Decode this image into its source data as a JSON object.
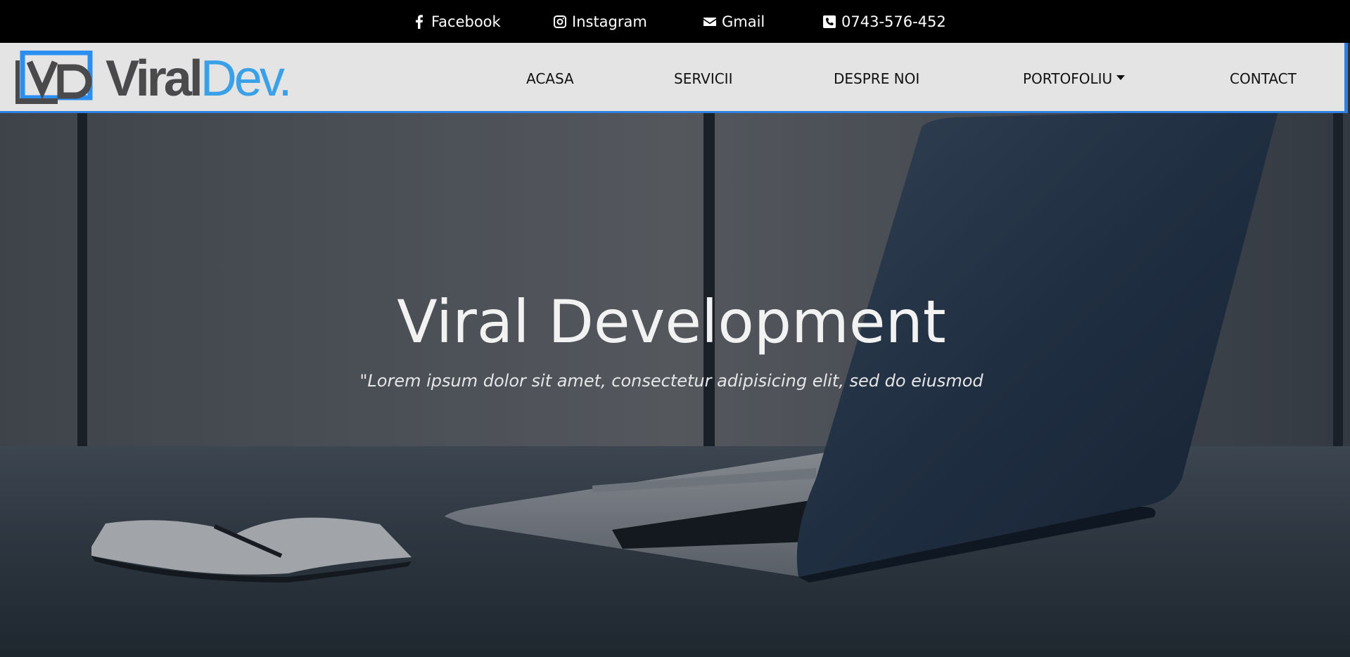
{
  "topbar": {
    "facebook": {
      "label": "Facebook",
      "icon": "facebook-icon"
    },
    "instagram": {
      "label": "Instagram",
      "icon": "instagram-icon"
    },
    "gmail": {
      "label": "Gmail",
      "icon": "envelope-icon"
    },
    "phone": {
      "label": "0743-576-452",
      "icon": "phone-icon"
    }
  },
  "brand": {
    "mark": "VD",
    "name_part1": "Viral",
    "name_part2": "Dev."
  },
  "nav": {
    "items": [
      {
        "label": "ACASA"
      },
      {
        "label": "SERVICII"
      },
      {
        "label": "DESPRE NOI"
      },
      {
        "label": "PORTOFOLIU",
        "has_dropdown": true
      },
      {
        "label": "CONTACT"
      }
    ]
  },
  "hero": {
    "title": "Viral Development",
    "subtitle": "\"Lorem ipsum dolor sit amet, consectetur adipisicing elit, sed do eiusmod"
  },
  "colors": {
    "accent": "#2f7fe0",
    "brand_blue": "#3aa0e8",
    "brand_gray": "#4a4a4c",
    "topbar_bg": "#000000",
    "navbar_bg": "#e4e4e4"
  }
}
